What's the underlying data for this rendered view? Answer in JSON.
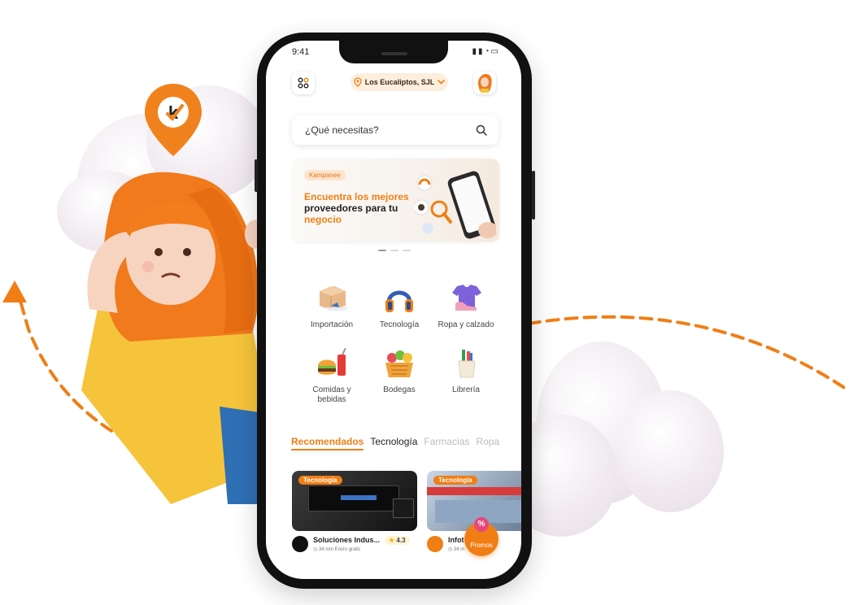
{
  "status_bar": {
    "time": "9:41"
  },
  "header": {
    "location": "Los Eucaliptos, SJL"
  },
  "search": {
    "placeholder": "¿Qué necesitas?"
  },
  "banner": {
    "brand": "Kampanee",
    "line1": "Encuentra los mejores",
    "line2": "proveedores para tu",
    "line3": "negocio"
  },
  "categories": [
    {
      "label": "Importación"
    },
    {
      "label": "Tecnología"
    },
    {
      "label": "Ropa y calzado"
    },
    {
      "label": "Comidas y bebidas"
    },
    {
      "label": "Bodegas"
    },
    {
      "label": "Librería"
    }
  ],
  "tabs": [
    {
      "label": "Recomendados"
    },
    {
      "label": "Tecnología"
    },
    {
      "label": "Farmacias"
    },
    {
      "label": "Ropa"
    }
  ],
  "cards": [
    {
      "badge": "Tecnología",
      "name": "Soluciones Indus...",
      "rating": "4.3",
      "meta": "34 min  Envío gratis"
    },
    {
      "badge": "Tecnología",
      "name": "Infot",
      "meta": "34 m"
    }
  ],
  "promos": {
    "icon": "%",
    "label": "Promos"
  },
  "colors": {
    "accent": "#f07e15",
    "pin": "#f0821d",
    "dash": "#f07e15"
  }
}
